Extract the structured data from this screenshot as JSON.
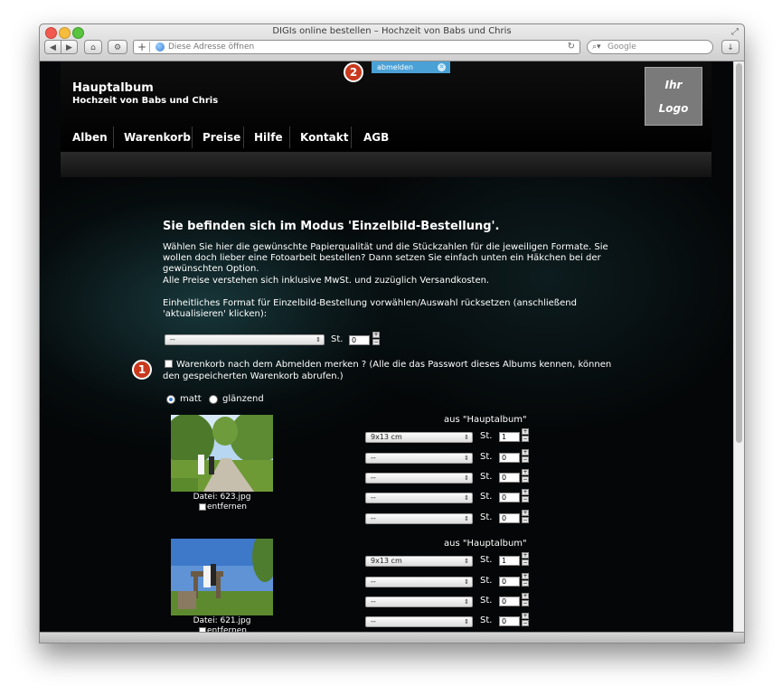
{
  "browser": {
    "window_title": "DIGIs online bestellen – Hochzeit von Babs und Chris",
    "url_placeholder": "Diese Adresse öffnen",
    "search_placeholder": "Google"
  },
  "header": {
    "album_title": "Hauptalbum",
    "album_subtitle": "Hochzeit von Babs und Chris",
    "logo_line1": "Ihr",
    "logo_line2": "Logo",
    "logout_label": "abmelden"
  },
  "nav": {
    "items": [
      "Alben",
      "Warenkorb",
      "Preise",
      "Hilfe",
      "Kontakt",
      "AGB"
    ]
  },
  "badges": [
    "1",
    "2"
  ],
  "main": {
    "heading": "Sie befinden sich im Modus 'Einzelbild-Bestellung'.",
    "intro_lines": [
      "Wählen Sie hier die gewünschte Papierqualität und die Stückzahlen für die jeweiligen Formate. Sie",
      "wollen doch lieber eine Fotoarbeit bestellen? Dann setzen Sie einfach unten ein Häkchen bei der",
      "gewünschten Option.",
      "Alle Preise verstehen sich inklusive MwSt. und zuzüglich Versandkosten."
    ],
    "format_lines": [
      "Einheitliches Format für Einzelbild-Bestellung vorwählen/Auswahl rücksetzen (anschließend",
      "'aktualisieren' klicken):"
    ],
    "global_format_value": "--",
    "st_label": "St.",
    "global_qty": "0",
    "remember_lines": [
      "Warenkorb nach dem Abmelden merken ? (Alle die das Passwort dieses Albums kennen, können",
      "den gespeicherten Warenkorb abrufen.)"
    ],
    "paper_options": [
      "matt",
      "glänzend"
    ],
    "selected_paper": "matt"
  },
  "photos": [
    {
      "filename": "Datei: 623.jpg",
      "remove_label": "entfernen",
      "source": "aus \"Hauptalbum\"",
      "rows": [
        {
          "format": "9x13 cm",
          "qty": "1"
        },
        {
          "format": "--",
          "qty": "0"
        },
        {
          "format": "--",
          "qty": "0"
        },
        {
          "format": "--",
          "qty": "0"
        },
        {
          "format": "--",
          "qty": "0"
        }
      ]
    },
    {
      "filename": "Datei: 621.jpg",
      "remove_label": "entfernen",
      "source": "aus \"Hauptalbum\"",
      "rows": [
        {
          "format": "9x13 cm",
          "qty": "1"
        },
        {
          "format": "--",
          "qty": "0"
        },
        {
          "format": "--",
          "qty": "0"
        },
        {
          "format": "--",
          "qty": "0"
        }
      ]
    }
  ]
}
